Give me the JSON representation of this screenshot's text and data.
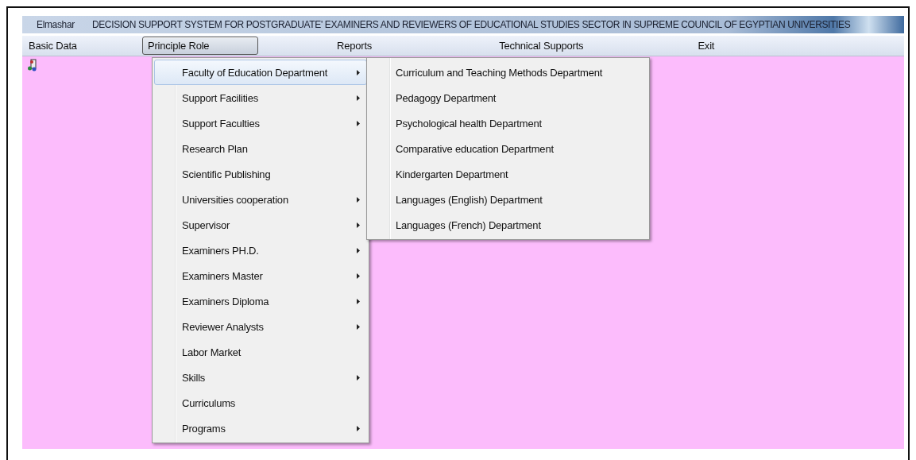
{
  "title_bar": {
    "app_name": "Elmashar",
    "title": "DECISION SUPPORT SYSTEM FOR POSTGRADUATE' EXAMINERS AND REVIEWERS OF EDUCATIONAL STUDIES SECTOR IN SUPREME COUNCIL OF EGYPTIAN UNIVERSITIES"
  },
  "menu_bar": [
    {
      "label": "Basic Data",
      "selected": false
    },
    {
      "label": "Principle  Role",
      "selected": true
    },
    {
      "label": "Reports",
      "selected": false
    },
    {
      "label": "Technical Supports",
      "selected": false
    },
    {
      "label": "Exit",
      "selected": false
    }
  ],
  "dropdown": [
    {
      "label": "Faculty of Education Department",
      "submenu": true,
      "selected": true
    },
    {
      "label": "Support Facilities",
      "submenu": true,
      "selected": false
    },
    {
      "label": "Support Faculties",
      "submenu": true,
      "selected": false
    },
    {
      "label": "Research Plan",
      "submenu": false,
      "selected": false
    },
    {
      "label": "Scientific Publishing",
      "submenu": false,
      "selected": false
    },
    {
      "label": "Universities cooperation",
      "submenu": true,
      "selected": false
    },
    {
      "label": "Supervisor",
      "submenu": true,
      "selected": false
    },
    {
      "label": "Examiners PH.D.",
      "submenu": true,
      "selected": false
    },
    {
      "label": "Examiners Master",
      "submenu": true,
      "selected": false
    },
    {
      "label": "Examiners Diploma",
      "submenu": true,
      "selected": false
    },
    {
      "label": "Reviewer Analysts",
      "submenu": true,
      "selected": false
    },
    {
      "label": "Labor Market",
      "submenu": false,
      "selected": false
    },
    {
      "label": "Skills",
      "submenu": true,
      "selected": false
    },
    {
      "label": "Curriculums",
      "submenu": false,
      "selected": false
    },
    {
      "label": "Programs",
      "submenu": true,
      "selected": false
    }
  ],
  "submenu": [
    {
      "label": "Curriculum and Teaching Methods Department"
    },
    {
      "label": "Pedagogy Department"
    },
    {
      "label": "Psychological health Department"
    },
    {
      "label": "Comparative education Department"
    },
    {
      "label": "Kindergarten Department"
    },
    {
      "label": "Languages  (English) Department"
    },
    {
      "label": "Languages (French) Department"
    }
  ]
}
